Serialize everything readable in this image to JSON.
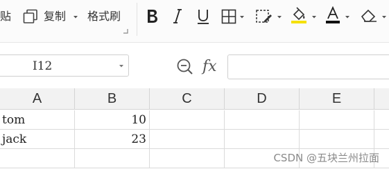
{
  "ribbon": {
    "paste_fragment": "贴",
    "copy_label": "复制",
    "format_painter_label": "格式刷",
    "icons": [
      "copy-icon",
      "bold-icon",
      "italic-icon",
      "underline-icon",
      "borders-icon",
      "cell-fill-icon",
      "highlight-color-icon",
      "font-color-icon",
      "clear-icon"
    ],
    "highlight_color": "#f5e000",
    "font_color": "#111111"
  },
  "formula_bar": {
    "cell_reference": "I12",
    "function_label": "fx",
    "formula_value": ""
  },
  "sheet": {
    "columns": [
      "A",
      "B",
      "C",
      "D",
      "E"
    ],
    "rows": [
      [
        "tom",
        "10",
        "",
        "",
        ""
      ],
      [
        "jack",
        "23",
        "",
        "",
        ""
      ],
      [
        "",
        "",
        "",
        "",
        ""
      ]
    ]
  },
  "watermark": "CSDN @五块兰州拉面"
}
